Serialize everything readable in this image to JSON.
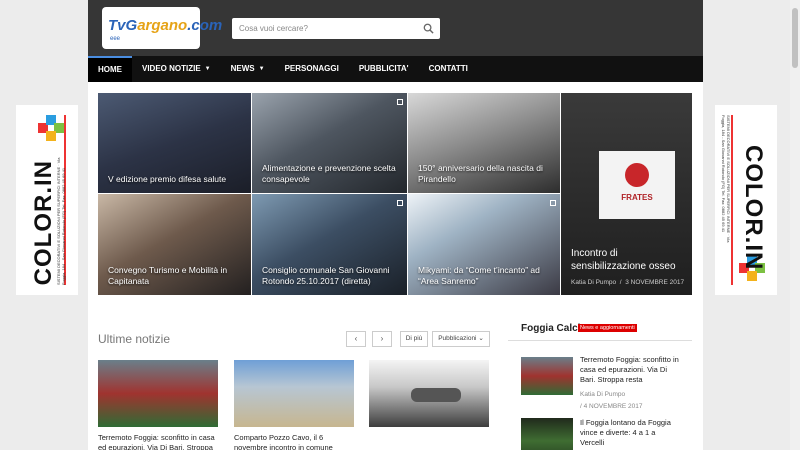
{
  "logo": {
    "brand_a": "TvG",
    "brand_b": "argano",
    "brand_c": ".com",
    "sub": "eee"
  },
  "search": {
    "placeholder": "Cosa vuoi cercare?"
  },
  "nav": [
    {
      "label": "HOME",
      "active": true
    },
    {
      "label": "VIDEO NOTIZIE",
      "dropdown": true
    },
    {
      "label": "NEWS",
      "dropdown": true
    },
    {
      "label": "PERSONAGGI"
    },
    {
      "label": "PUBBLICITA'"
    },
    {
      "label": "CONTATTI"
    }
  ],
  "featured": [
    {
      "caption": "V edizione premio difesa salute"
    },
    {
      "caption": "Alimentazione e prevenzione scelta consapevole"
    },
    {
      "caption": "150° anniversario della nascita di Pirandello"
    },
    {
      "caption": "Convegno Turismo e Mobilità in Capitanata"
    },
    {
      "caption": "Consiglio comunale San Giovanni Rotondo 25.10.2017 (diretta)"
    },
    {
      "caption": "Mikyami: da “Come t’incanto” ad “Area Sanremo”"
    }
  ],
  "featured_big": {
    "caption": "Incontro di sensibilizzazione osseo",
    "author": "Katia Di Pumpo",
    "date": "3 NOVEMBRE 2017",
    "banner": "FRATES"
  },
  "ultime": {
    "title": "Ultime notizie",
    "prev": "‹",
    "next": "›",
    "more": "Di più",
    "filter": "Pubblicazioni",
    "items": [
      {
        "title": "Terremoto Foggia: sconfitto in casa ed epurazioni. Via Di Bari. Stroppa"
      },
      {
        "title": "Comparto Pozzo Cavo, il 6 novembre incontro in comune"
      },
      {
        "title": ""
      }
    ]
  },
  "sidebar": {
    "title": "Foggia Calcio",
    "badge": "News e aggiornamenti",
    "items": [
      {
        "title": "Terremoto Foggia: sconfitto in casa ed epurazioni. Via Di Bari. Stroppa resta",
        "author": "Katia Di Pumpo",
        "date": "/ 4 NOVEMBRE 2017"
      },
      {
        "title": "Il Foggia lontano da Foggia vince e diverte: 4 a 1 a Vercelli"
      }
    ]
  },
  "ads": {
    "brand": "COLOR.IN",
    "tagline": "...Decora il tuo interno",
    "details": "SISTEMI DECORATIVI E SOLUZIONI PER SUPERFICI INTERNE · Via Foggia, 184 - San Giovanni Rotondo (FG) Tel. Fax: 0882 45 69 41"
  },
  "colors": {
    "accent": "#4a8de0",
    "header": "#363636",
    "nav": "#111111",
    "badge": "#dd0000"
  }
}
